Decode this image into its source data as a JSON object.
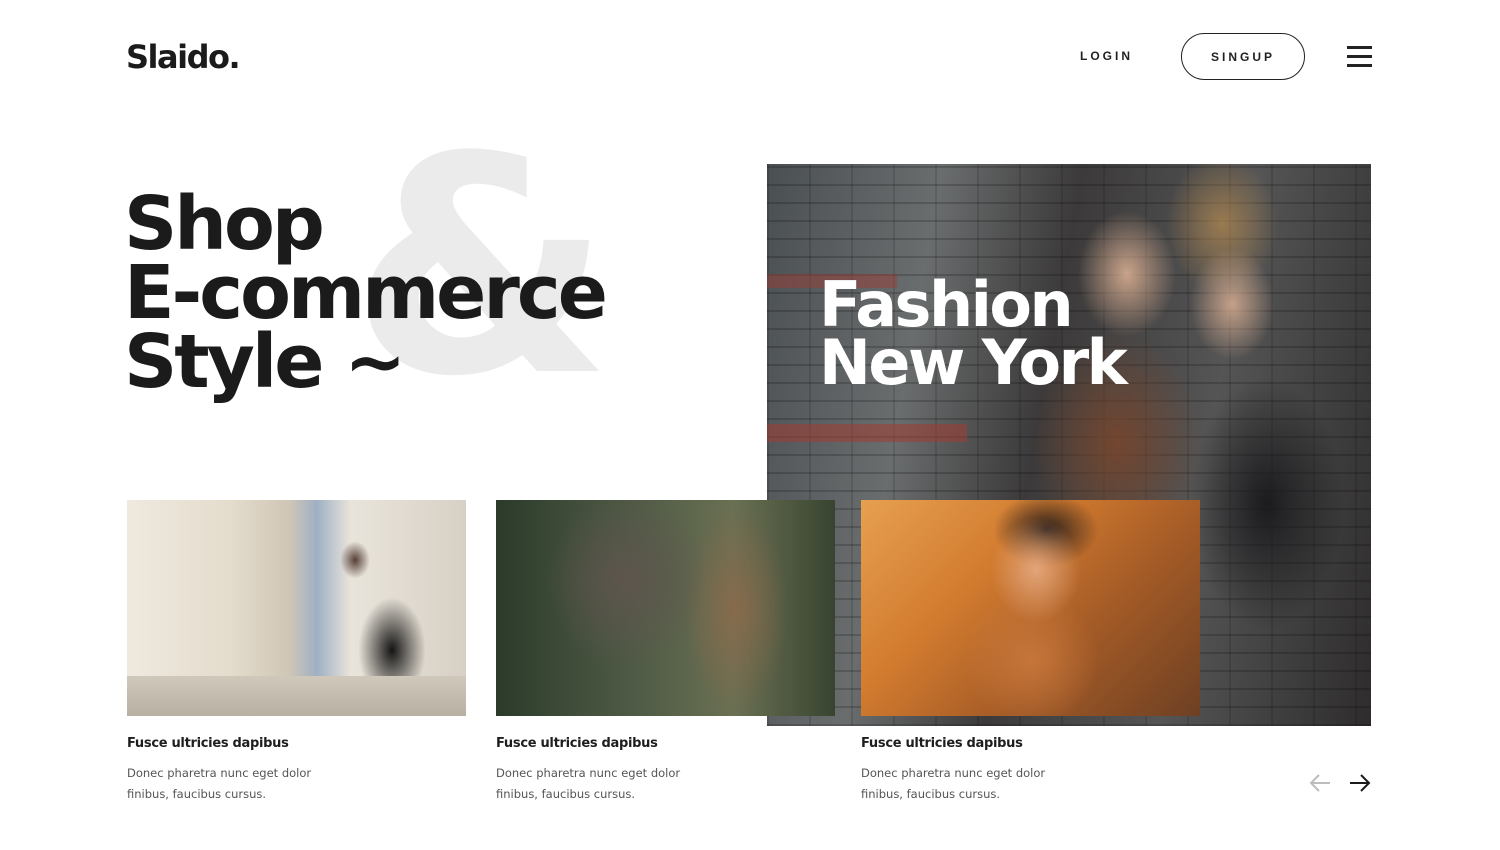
{
  "header": {
    "logo": "Slaido.",
    "login_label": "LOGIN",
    "signup_label": "SINGUP"
  },
  "hero": {
    "title_lines": [
      "Shop",
      "E-commerce",
      "Style ~"
    ],
    "ampersand": "&"
  },
  "feature": {
    "title_lines": [
      "Fashion",
      "New York"
    ]
  },
  "cards": [
    {
      "title": "Fusce ultricies dapibus",
      "desc": "Donec pharetra nunc eget dolor finibus, faucibus cursus."
    },
    {
      "title": "Fusce ultricies dapibus",
      "desc": "Donec pharetra nunc eget dolor finibus, faucibus cursus."
    },
    {
      "title": "Fusce ultricies dapibus",
      "desc": "Donec pharetra nunc eget dolor finibus, faucibus cursus."
    }
  ],
  "slider": {
    "prev_icon": "arrow-left-icon",
    "next_icon": "arrow-right-icon",
    "prev_color": "#bdbdbd",
    "next_color": "#1b1b1b"
  }
}
